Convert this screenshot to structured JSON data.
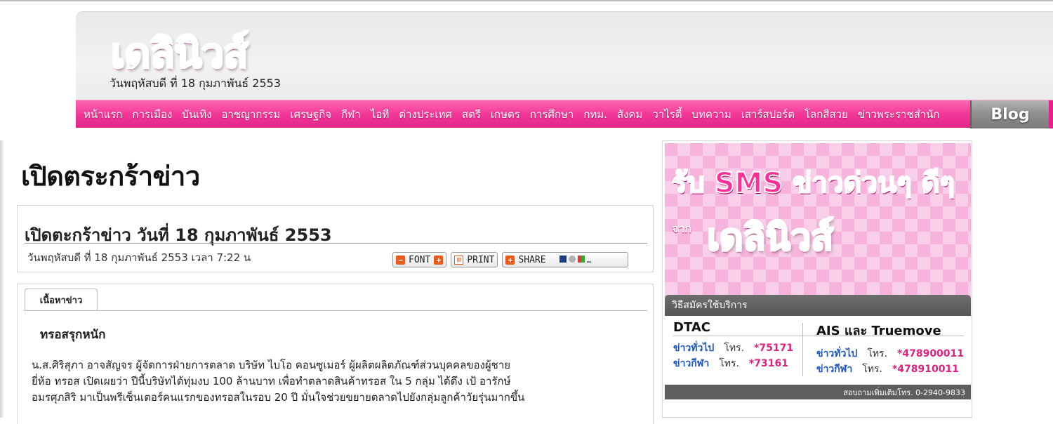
{
  "header": {
    "logo_text": "เดลินิวส์",
    "date": "วันพฤหัสบดี ที่ 18 กุมภาพันธ์ 2553"
  },
  "nav": {
    "items": [
      "หน้าแรก",
      "การเมือง",
      "บันเทิง",
      "อาชญากรรม",
      "เศรษฐกิจ",
      "กีฬา",
      "ไอที",
      "ต่างประเทศ",
      "สตรี",
      "เกษตร",
      "การศึกษา",
      "กทม.",
      "สังคม",
      "วาไรตี้",
      "บทความ",
      "เสาร์สปอร์ต",
      "โลกสีสวย",
      "ข่าวพระราชสำนัก"
    ],
    "blog_label": "Blog"
  },
  "page": {
    "title": "เปิดตระกร้าข่าว"
  },
  "article": {
    "title": "เปิดตะกร้าข่าว วันที่ 18 กุมภาพันธ์ 2553",
    "meta": "วันพฤหัสบดี ที่ 18 กุมภาพันธ์ 2553 เวลา 7:22 น",
    "tools": {
      "font_label": "FONT",
      "print_label": "PRINT",
      "share_label": "SHARE"
    },
    "tab_label": "เนื้อหาข่าว",
    "subhead": "ทรอสรุกหนัก",
    "body_lines": [
      "น.ส.ศิริสุภา อาจสัญจร ผู้จัดการฝ่ายการตลาด บริษัท ไบโอ คอนซูเมอร์  ผู้ผลิตผลิตภัณฑ์ส่วนบุคคลของผู้ชาย",
      "ยี่ห้อ ทรอส เปิดเผยว่า ปีนี้บริษัทได้ทุ่มงบ 100 ล้านบาท เพื่อทำตลาดสินค้าทรอส ใน 5 กลุ่ม ได้ดึง เป้ อารักษ์",
      "อมรศุภสิริ มาเป็นพรีเซ็นเตอร์คนแรกของทรอสในรอบ 20 ปี มั่นใจช่วยขยายตลาดไปยังกลุ่มลูกค้าวัยรุ่นมากขึ้น"
    ]
  },
  "ad": {
    "headline": "รับ SMS ข่าวด่วนๆ ดีๆ",
    "from": "จาก",
    "logo_text": "เดลินิวส์",
    "signup_label": "วิธีสมัครใช้บริการ",
    "dtac": {
      "title": "DTAC",
      "rows": [
        {
          "label": "ข่าวทั่วไป",
          "tel": "โทร.",
          "number": "*75171"
        },
        {
          "label": "ข่าวกีฬา",
          "tel": "โทร.",
          "number": "*73161"
        }
      ]
    },
    "ais": {
      "title": "AIS และ Truemove",
      "rows": [
        {
          "label": "ข่าวทั่วไป",
          "tel": "โทร.",
          "number": "*478900011"
        },
        {
          "label": "ข่าวกีฬา",
          "tel": "โทร.",
          "number": "*478910011"
        }
      ]
    },
    "footer": "สอบถามเพิ่มเติมโทร. 0-2940-9833"
  },
  "colors": {
    "brand_pink": "#f23897",
    "blog_gray": "#8e8e8e",
    "link_blue": "#1a55c4"
  }
}
